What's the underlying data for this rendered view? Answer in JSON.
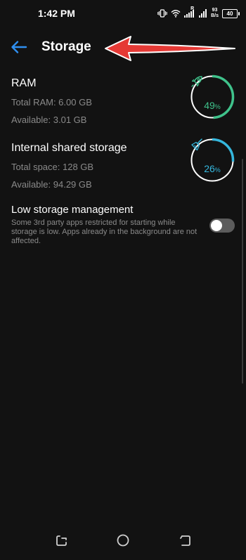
{
  "status_bar": {
    "time": "1:42 PM",
    "net_speed_value": "93",
    "net_speed_unit": "B/s",
    "signal_marker": "R",
    "battery": "40"
  },
  "header": {
    "title": "Storage",
    "back_icon": "back-arrow-icon"
  },
  "ram": {
    "title": "RAM",
    "total": "Total RAM: 6.00 GB",
    "available": "Available: 3.01 GB",
    "percent_value": "49",
    "percent_sign": "%",
    "percent_fraction": 0.49,
    "icon": "rocket-icon",
    "color": "#3fc28b"
  },
  "internal_storage": {
    "title": "Internal shared storage",
    "total": "Total space: 128 GB",
    "available": "Available: 94.29 GB",
    "percent_value": "26",
    "percent_sign": "%",
    "percent_fraction": 0.26,
    "icon": "broom-icon",
    "color": "#35b7dd"
  },
  "low_storage": {
    "title": "Low storage management",
    "description": "Some 3rd party apps restricted for starting while storage is low. Apps already in the background are not affected.",
    "enabled": false
  },
  "nav": {
    "recents": "recents-icon",
    "home": "home-icon",
    "back": "back-icon"
  },
  "colors": {
    "background": "#121212",
    "accent_blue": "#2f8ff0",
    "annotation_red": "#e53935"
  }
}
